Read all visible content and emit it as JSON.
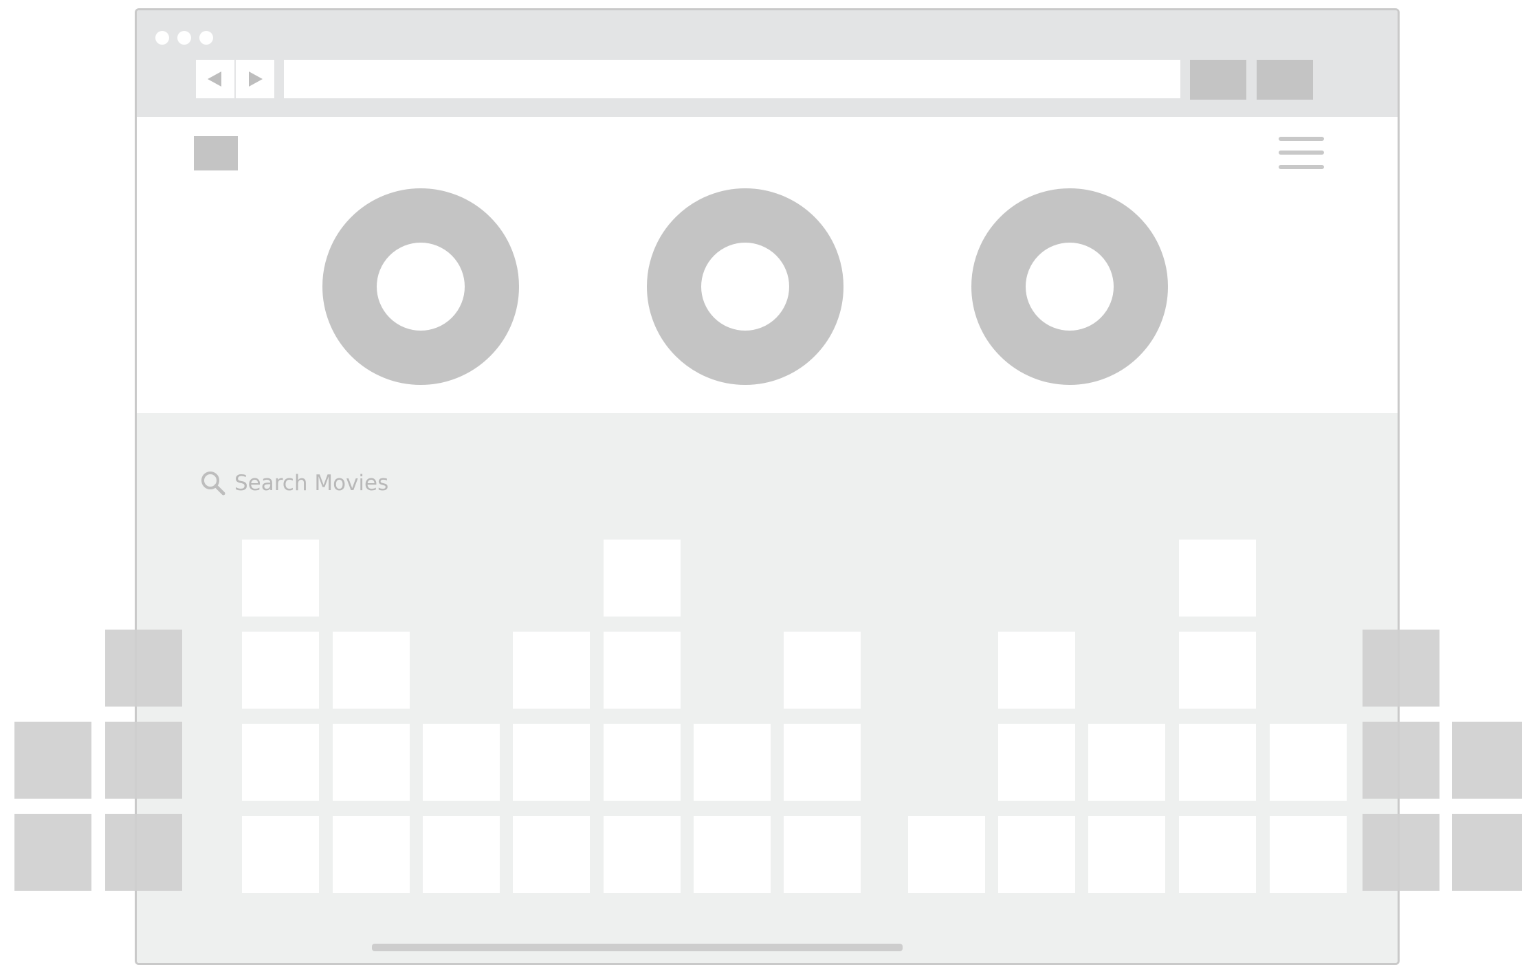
{
  "browser": {
    "address": "",
    "back_icon": "back-arrow-icon",
    "forward_icon": "forward-arrow-icon"
  },
  "header": {
    "menu_icon": "hamburger-menu-icon"
  },
  "search": {
    "placeholder": "Search Movies",
    "icon": "search-icon"
  },
  "colors": {
    "titlebar": "#e3e4e5",
    "placeholder_gray": "#c4c4c4",
    "content_bg": "#eef0ef",
    "tile": "#ffffff"
  }
}
